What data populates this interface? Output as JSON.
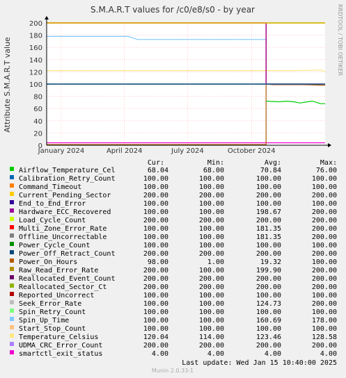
{
  "title": "S.M.A.R.T values for /c0/e8/s0 - by year",
  "side_label": "RRDTOOL / TOBI OETIKER",
  "footer": "Munin 2.0.33-1",
  "chart_data": {
    "type": "line",
    "ylabel": "Attribute S.M.A.R.T value",
    "ylim": [
      0,
      200
    ],
    "yticks": [
      0,
      20,
      40,
      60,
      80,
      100,
      120,
      140,
      160,
      180,
      200
    ],
    "xlim": [
      "2023-12-11",
      "2025-01-15"
    ],
    "xticks": [
      {
        "date": "2024-01-01",
        "label": "January 2024"
      },
      {
        "date": "2024-04-01",
        "label": "April 2024"
      },
      {
        "date": "2024-07-01",
        "label": "July 2024"
      },
      {
        "date": "2024-10-01",
        "label": "October 2024"
      }
    ],
    "grid": true,
    "legend_headers": [
      "Cur:",
      "Min:",
      "Avg:",
      "Max:"
    ],
    "series": [
      {
        "name": "Airflow_Temperature_Cel",
        "color": "#00cc00",
        "cur": "68.04",
        "min": "68.00",
        "avg": "70.84",
        "max": "76.00",
        "points": [
          [
            "2024-10-22",
            72
          ],
          [
            "2024-11-10",
            71
          ],
          [
            "2024-11-20",
            72
          ],
          [
            "2024-12-01",
            71
          ],
          [
            "2024-12-10",
            69
          ],
          [
            "2024-12-20",
            71
          ],
          [
            "2024-12-28",
            72
          ],
          [
            "2025-01-03",
            70
          ],
          [
            "2025-01-08",
            68
          ],
          [
            "2025-01-15",
            68
          ]
        ]
      },
      {
        "name": "Calibration_Retry_Count",
        "color": "#0066b3",
        "cur": "100.00",
        "min": "100.00",
        "avg": "100.00",
        "max": "100.00",
        "points": [
          [
            "2023-12-11",
            100
          ],
          [
            "2025-01-15",
            100
          ]
        ]
      },
      {
        "name": "Command_Timeout",
        "color": "#ff8000",
        "cur": "100.00",
        "min": "100.00",
        "avg": "100.00",
        "max": "100.00",
        "points": [
          [
            "2023-12-11",
            100
          ],
          [
            "2025-01-15",
            100
          ]
        ]
      },
      {
        "name": "Current_Pending_Sector",
        "color": "#ffcc00",
        "cur": "200.00",
        "min": "200.00",
        "avg": "200.00",
        "max": "200.00",
        "points": [
          [
            "2023-12-11",
            200
          ],
          [
            "2025-01-15",
            200
          ]
        ]
      },
      {
        "name": "End_to_End_Error",
        "color": "#330099",
        "cur": "100.00",
        "min": "100.00",
        "avg": "100.00",
        "max": "100.00",
        "points": [
          [
            "2023-12-11",
            100
          ],
          [
            "2025-01-15",
            100
          ]
        ]
      },
      {
        "name": "Hardware_ECC_Recovered",
        "color": "#990099",
        "cur": "100.00",
        "min": "100.00",
        "avg": "198.67",
        "max": "200.00",
        "points": [
          [
            "2023-12-11",
            200
          ],
          [
            "2024-10-22",
            200
          ],
          [
            "2024-10-22",
            100
          ],
          [
            "2025-01-15",
            100
          ]
        ]
      },
      {
        "name": "Load_Cycle_Count",
        "color": "#ccff00",
        "cur": "200.00",
        "min": "200.00",
        "avg": "200.00",
        "max": "200.00",
        "points": [
          [
            "2023-12-11",
            200
          ],
          [
            "2025-01-15",
            200
          ]
        ]
      },
      {
        "name": "Multi_Zone_Error_Rate",
        "color": "#ff0000",
        "cur": "100.00",
        "min": "100.00",
        "avg": "181.35",
        "max": "200.00",
        "points": [
          [
            "2023-12-11",
            200
          ],
          [
            "2024-10-22",
            200
          ],
          [
            "2024-10-22",
            100
          ],
          [
            "2025-01-15",
            100
          ]
        ]
      },
      {
        "name": "Offline_Uncorrectable",
        "color": "#808080",
        "cur": "100.00",
        "min": "100.00",
        "avg": "181.35",
        "max": "200.00",
        "points": [
          [
            "2023-12-11",
            200
          ],
          [
            "2024-10-22",
            200
          ],
          [
            "2024-10-22",
            100
          ],
          [
            "2025-01-15",
            100
          ]
        ]
      },
      {
        "name": "Power_Cycle_Count",
        "color": "#008f00",
        "cur": "100.00",
        "min": "100.00",
        "avg": "100.00",
        "max": "100.00",
        "points": [
          [
            "2023-12-11",
            100
          ],
          [
            "2025-01-15",
            100
          ]
        ]
      },
      {
        "name": "Power_Off_Retract_Count",
        "color": "#00487d",
        "cur": "200.00",
        "min": "200.00",
        "avg": "200.00",
        "max": "200.00",
        "points": [
          [
            "2023-12-11",
            200
          ],
          [
            "2025-01-15",
            200
          ]
        ]
      },
      {
        "name": "Power_On_Hours",
        "color": "#b35a00",
        "cur": "98.00",
        "min": "1.00",
        "avg": "19.32",
        "max": "100.00",
        "points": [
          [
            "2023-12-11",
            1
          ],
          [
            "2024-10-22",
            1
          ],
          [
            "2024-10-22",
            100
          ],
          [
            "2024-11-01",
            99
          ],
          [
            "2024-12-15",
            99
          ],
          [
            "2025-01-15",
            98
          ]
        ]
      },
      {
        "name": "Raw_Read_Error_Rate",
        "color": "#b38f00",
        "cur": "200.00",
        "min": "100.00",
        "avg": "199.90",
        "max": "200.00",
        "points": [
          [
            "2023-12-11",
            200
          ],
          [
            "2025-01-15",
            200
          ]
        ]
      },
      {
        "name": "Reallocated_Event_Count",
        "color": "#6b006b",
        "cur": "200.00",
        "min": "200.00",
        "avg": "200.00",
        "max": "200.00",
        "points": [
          [
            "2023-12-11",
            200
          ],
          [
            "2025-01-15",
            200
          ]
        ]
      },
      {
        "name": "Reallocated_Sector_Ct",
        "color": "#8fb300",
        "cur": "200.00",
        "min": "200.00",
        "avg": "200.00",
        "max": "200.00",
        "points": [
          [
            "2023-12-11",
            200
          ],
          [
            "2025-01-15",
            200
          ]
        ]
      },
      {
        "name": "Reported_Uncorrect",
        "color": "#b30000",
        "cur": "100.00",
        "min": "100.00",
        "avg": "100.00",
        "max": "100.00",
        "points": [
          [
            "2023-12-11",
            100
          ],
          [
            "2025-01-15",
            100
          ]
        ]
      },
      {
        "name": "Seek_Error_Rate",
        "color": "#bebebe",
        "cur": "100.00",
        "min": "100.00",
        "avg": "124.73",
        "max": "200.00",
        "points": [
          [
            "2023-12-11",
            100
          ],
          [
            "2024-10-22",
            100
          ],
          [
            "2025-01-15",
            100
          ]
        ]
      },
      {
        "name": "Spin_Retry_Count",
        "color": "#80ff80",
        "cur": "100.00",
        "min": "100.00",
        "avg": "100.00",
        "max": "100.00",
        "points": [
          [
            "2023-12-11",
            100
          ],
          [
            "2025-01-15",
            100
          ]
        ]
      },
      {
        "name": "Spin_Up_Time",
        "color": "#80c9ff",
        "cur": "100.00",
        "min": "100.00",
        "avg": "160.69",
        "max": "178.00",
        "points": [
          [
            "2023-12-11",
            178
          ],
          [
            "2024-04-06",
            178
          ],
          [
            "2024-04-20",
            173
          ],
          [
            "2024-10-22",
            173
          ],
          [
            "2024-10-22",
            100
          ],
          [
            "2025-01-15",
            100
          ]
        ]
      },
      {
        "name": "Start_Stop_Count",
        "color": "#ffc080",
        "cur": "100.00",
        "min": "100.00",
        "avg": "100.00",
        "max": "100.00",
        "points": [
          [
            "2023-12-11",
            100
          ],
          [
            "2025-01-15",
            100
          ]
        ]
      },
      {
        "name": "Temperature_Celsius",
        "color": "#ffe680",
        "cur": "120.04",
        "min": "114.00",
        "avg": "123.46",
        "max": "128.58",
        "points": [
          [
            "2023-12-11",
            122
          ],
          [
            "2024-10-22",
            122
          ],
          [
            "2024-12-01",
            122
          ],
          [
            "2025-01-10",
            123
          ],
          [
            "2025-01-15",
            120
          ]
        ]
      },
      {
        "name": "UDMA_CRC_Error_Count",
        "color": "#aa80ff",
        "cur": "200.00",
        "min": "200.00",
        "avg": "200.00",
        "max": "200.00",
        "points": [
          [
            "2023-12-11",
            200
          ],
          [
            "2025-01-15",
            200
          ]
        ]
      },
      {
        "name": "smartctl_exit_status",
        "color": "#ee00cc",
        "cur": "4.00",
        "min": "4.00",
        "avg": "4.00",
        "max": "4.00",
        "points": [
          [
            "2023-12-11",
            4
          ],
          [
            "2025-01-15",
            4
          ]
        ]
      }
    ],
    "last_update": "Last update: Wed Jan 15 10:40:00 2025"
  }
}
